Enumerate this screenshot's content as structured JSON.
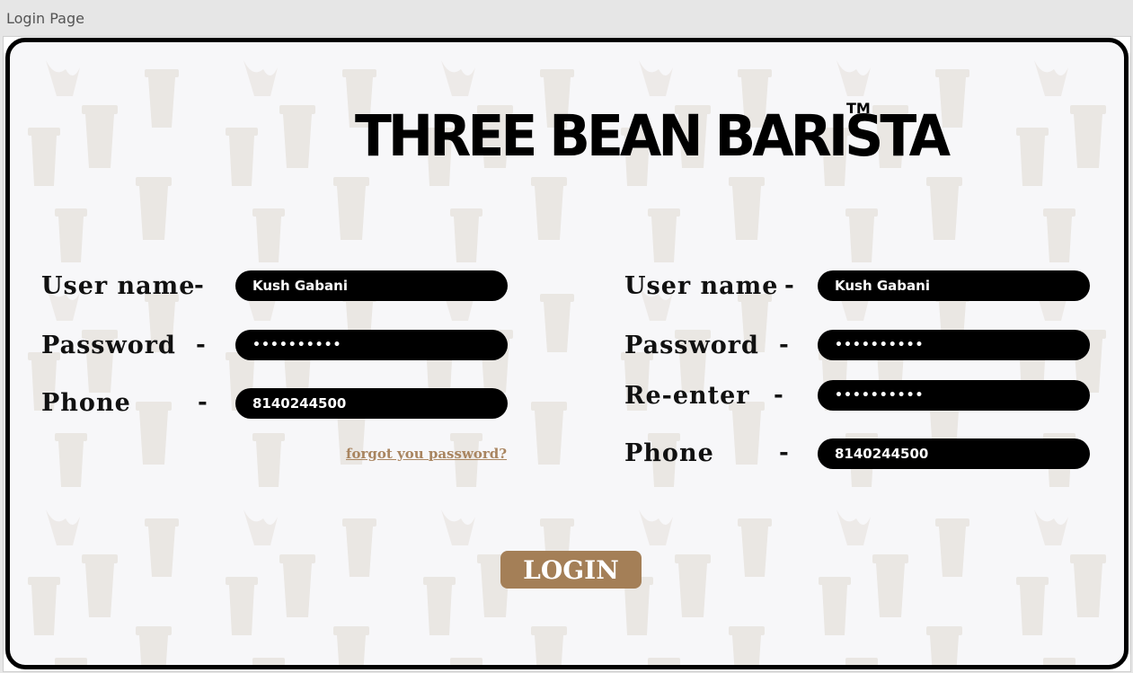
{
  "window": {
    "title": "Login Page"
  },
  "brand": {
    "name": "THREE BEAN BARISTA",
    "trademark": "TM"
  },
  "login_form": {
    "username_label": "User name",
    "password_label": "Password",
    "phone_label": "Phone",
    "username_value": "Kush Gabani",
    "password_value": "••••••••••",
    "phone_value": "8140244500",
    "forgot_link": "forgot you password?"
  },
  "signup_form": {
    "username_label": "User name",
    "password_label": "Password",
    "reenter_label": "Re-enter",
    "phone_label": "Phone",
    "username_value": "Kush Gabani",
    "password_value": "••••••••••",
    "reenter_value": "••••••••••",
    "phone_value": "8140244500"
  },
  "separator": "-",
  "login_button": "LOGIN",
  "colors": {
    "accent": "#a47f57",
    "link": "#a98560",
    "field_bg": "#000000",
    "panel_bg": "#f7f7f9"
  }
}
